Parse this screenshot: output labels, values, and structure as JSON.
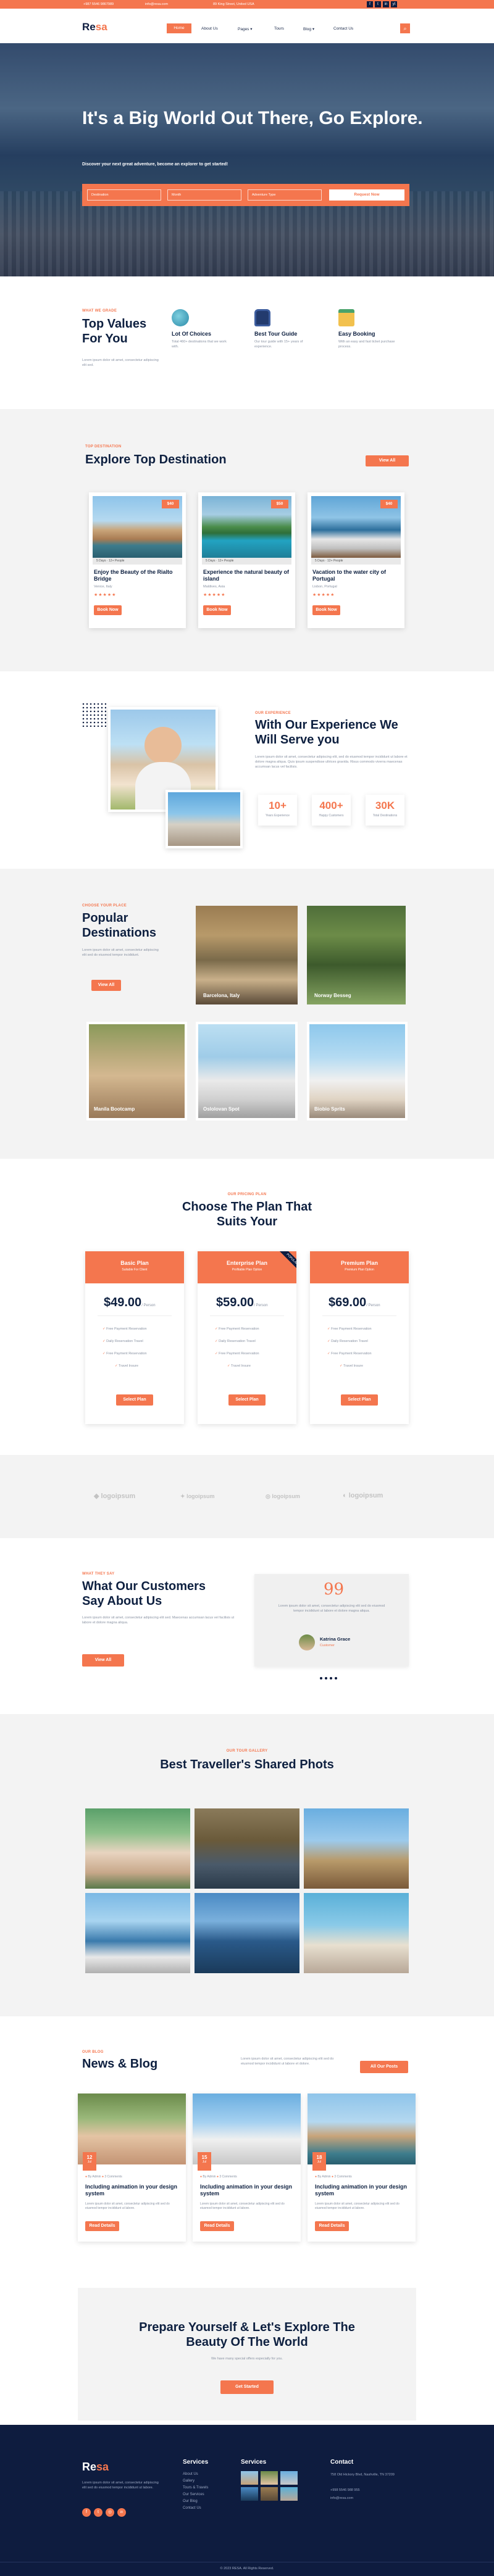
{
  "topbar": {
    "phone": "+987 5546 9867989",
    "email": "info@resa.com",
    "address": "89 King Street, United USA",
    "social": [
      "f",
      "t",
      "in",
      "yt"
    ]
  },
  "nav": {
    "logo_main": "Re",
    "logo_accent": "sa",
    "items": [
      {
        "label": "Home",
        "active": true
      },
      {
        "label": "About Us"
      },
      {
        "label": "Pages ▾"
      },
      {
        "label": "Tours"
      },
      {
        "label": "Blog ▾"
      },
      {
        "label": "Contact Us"
      }
    ]
  },
  "hero": {
    "title": "It's a Big World Out There, Go Explore.",
    "subtitle": "Discover your next great adventure, become an explorer to get started!",
    "fields": [
      "Destination",
      "Month",
      "Adventure Type"
    ],
    "button": "Request Now"
  },
  "values": {
    "eyebrow": "WHAT WE GRADE",
    "title": "Top Values For You",
    "text": "Lorem ipsum dolor sit amet, consectetur adipiscing elit sed.",
    "items": [
      {
        "icon": "globe-icon",
        "title": "Lot Of Choices",
        "text": "Total 460+ destinations that we work with."
      },
      {
        "icon": "backpack-icon",
        "title": "Best Tour Guide",
        "text": "Our tour guide with 15+ years of experience."
      },
      {
        "icon": "booking-icon",
        "title": "Easy Booking",
        "text": "With an easy and fast ticket purchase process."
      }
    ]
  },
  "destinations": {
    "eyebrow": "TOP DESTINATION",
    "title": "Explore Top Destination",
    "view_all": "View All",
    "cards": [
      {
        "price": "$40",
        "days": "5 Days",
        "persons": "12+ People",
        "title": "Enjoy the Beauty of the Rialto Bridge",
        "location": "Venice, Italy",
        "button": "Book Now"
      },
      {
        "price": "$50",
        "days": "5 Days",
        "persons": "12+ People",
        "title": "Experience the natural beauty of island",
        "location": "Maldives, Asia",
        "button": "Book Now"
      },
      {
        "price": "$40",
        "days": "5 Days",
        "persons": "12+ People",
        "title": "Vacation to the water city of Portugal",
        "location": "Lisbon, Portugal",
        "button": "Book Now"
      }
    ]
  },
  "experience": {
    "eyebrow": "OUR EXPERIENCE",
    "title": "With Our Experience We Will Serve you",
    "text": "Lorem ipsum dolor sit amet, consectetur adipiscing elit, sed do eiusmod tempor incididunt ut labore et dolore magna aliqua. Quis ipsum suspendisse ultrices gravida. Risus commodo viverra maecenas accumsan lacus vel facilisis.",
    "stats": [
      {
        "value": "10+",
        "label": "Years Experience"
      },
      {
        "value": "400+",
        "label": "Happy Customers"
      },
      {
        "value": "30K",
        "label": "Total Destinations"
      }
    ]
  },
  "popular": {
    "eyebrow": "CHOOSE YOUR PLACE",
    "title": "Popular Destinations",
    "text": "Lorem ipsum dolor sit amet, consectetur adipiscing elit sed do eiusmod tempor incididunt.",
    "button": "View All",
    "places": [
      "Barcelona, Italy",
      "Norway Besseg",
      "Manila Bootcamp",
      "Oslolovan Spot",
      "Biobio Sprits"
    ]
  },
  "pricing": {
    "eyebrow": "OUR PRICING PLAN",
    "title": "Choose The Plan That Suits Your",
    "plans": [
      {
        "name": "Basic Plan",
        "sub": "Suitable For Client",
        "price": "49.00",
        "unit": "/ Person",
        "features": [
          "Free Payment Reservation",
          "Daily Reservation Travel",
          "Free Payment Reservation",
          "Travel Insure"
        ],
        "button": "Select Plan"
      },
      {
        "name": "Enterprise Plan",
        "sub": "Profitable Plan Option",
        "price": "59.00",
        "unit": "/ Person",
        "features": [
          "Free Payment Reservation",
          "Daily Reservation Travel",
          "Free Payment Reservation",
          "Travel Insure"
        ],
        "button": "Select Plan",
        "ribbon": "POPULAR"
      },
      {
        "name": "Premium Plan",
        "sub": "Premium Plan Option",
        "price": "69.00",
        "unit": "/ Person",
        "features": [
          "Free Payment Reservation",
          "Daily Reservation Travel",
          "Free Payment Reservation",
          "Travel Insure"
        ],
        "button": "Select Plan"
      }
    ]
  },
  "logos": [
    "logoipsum",
    "logoipsum",
    "logoipsum",
    "logoipsum"
  ],
  "testimonials": {
    "eyebrow": "WHAT THEY SAY",
    "title": "What Our Customers Say About Us",
    "text": "Lorem ipsum dolor sit amet, consectetur adipiscing elit sed. Maecenas accumsan lacus vel facilisis ut labore et dolore magna aliqua.",
    "button": "View All",
    "quote": "Lorem ipsum dolor sit amet, consectetur adipiscing elit sed do eiusmod tempor incididunt ut labore et dolore magna aliqua.",
    "name": "Katrina Grace",
    "role": "Customer"
  },
  "gallery": {
    "eyebrow": "OUR TOUR GALLERY",
    "title": "Best Traveller's Shared Phots"
  },
  "blog": {
    "eyebrow": "OUR BLOG",
    "title": "News & Blog",
    "text": "Lorem ipsum dolor sit amet, consectetur adipiscing elit sed do eiusmod tempor incididunt ut labore et dolore.",
    "button": "All Our Posts",
    "posts": [
      {
        "day": "12",
        "month": "Jul",
        "author": "By Admin",
        "comments": "3 Comments",
        "title": "Including animation in your design system",
        "text": "Lorem ipsum dolor sit amet, consectetur adipiscing elit sed do eiusmod tempor incididunt ut labore.",
        "button": "Read Details"
      },
      {
        "day": "15",
        "month": "Jul",
        "author": "By Admin",
        "comments": "3 Comments",
        "title": "Including animation in your design system",
        "text": "Lorem ipsum dolor sit amet, consectetur adipiscing elit sed do eiusmod tempor incididunt ut labore.",
        "button": "Read Details"
      },
      {
        "day": "18",
        "month": "Jul",
        "author": "By Admin",
        "comments": "3 Comments",
        "title": "Including animation in your design system",
        "text": "Lorem ipsum dolor sit amet, consectetur adipiscing elit sed do eiusmod tempor incididunt ut labore.",
        "button": "Read Details"
      }
    ]
  },
  "cta": {
    "title": "Prepare Yourself & Let's Explore The Beauty Of The World",
    "text": "We have many special offers especially for you.",
    "button": "Get Started"
  },
  "footer": {
    "logo_main": "Re",
    "logo_accent": "sa",
    "text": "Lorem ipsum dolor sit amet, consectetur adipiscing elit sed do eiusmod tempor incididunt ut labore.",
    "services_title": "Services",
    "services": [
      "About Us",
      "Gallery",
      "Tours & Travels",
      "Our Services",
      "Our Blog",
      "Contact Us"
    ],
    "gallery_title": "Services",
    "contact_title": "Contact",
    "address": "758 Old Hickory Blvd, Nashville, TN 37209",
    "phone": "+998 5546 988 955",
    "email": "info@resa.com",
    "copyright": "© 2023 RESA. All Rights Reserved."
  },
  "colors": {
    "accent": "#f4764e",
    "navy": "#0e1c3f"
  }
}
